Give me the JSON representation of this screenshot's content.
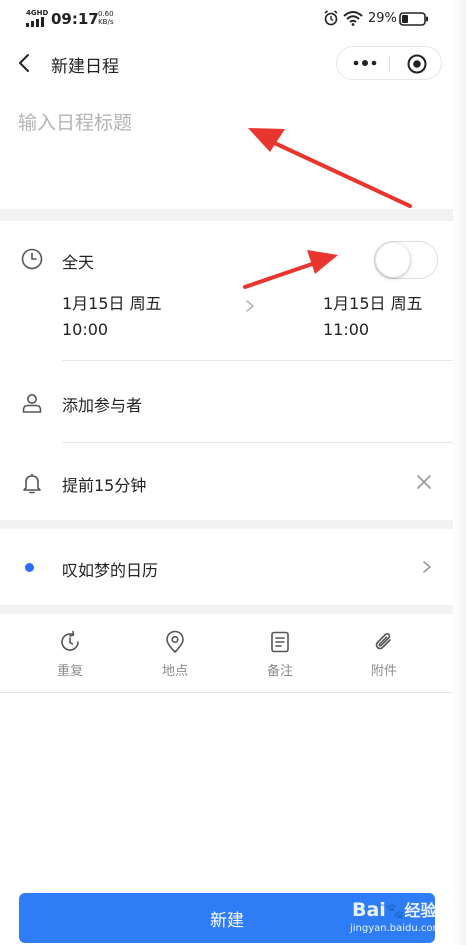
{
  "status_bar": {
    "network": "4GHD",
    "time": "09:17",
    "speed_value": "0.60",
    "speed_unit": "KB/s",
    "battery": "29%"
  },
  "header": {
    "title": "新建日程"
  },
  "event_title": {
    "placeholder": "输入日程标题",
    "value": ""
  },
  "all_day": {
    "label": "全天",
    "enabled": false
  },
  "time_range": {
    "start_date": "1月15日 周五",
    "start_time": "10:00",
    "end_date": "1月15日 周五",
    "end_time": "11:00"
  },
  "participants": {
    "label": "添加参与者"
  },
  "reminder": {
    "label": "提前15分钟"
  },
  "calendar": {
    "label": "叹如梦的日历",
    "dot_color": "#2a6cff"
  },
  "tools": [
    {
      "label": "重复",
      "icon": "repeat-icon"
    },
    {
      "label": "地点",
      "icon": "location-icon"
    },
    {
      "label": "备注",
      "icon": "note-icon"
    },
    {
      "label": "附件",
      "icon": "attachment-icon"
    }
  ],
  "create_button": {
    "label": "新建",
    "color": "#2e7df6"
  },
  "watermark": {
    "brand": "Bai",
    "brand_suffix": "经验",
    "url": "jingyan.baidu.com"
  },
  "colors": {
    "annotation_arrow": "#e8352e",
    "separator": "#f2f2f2",
    "muted_text": "#8c8c8c"
  }
}
